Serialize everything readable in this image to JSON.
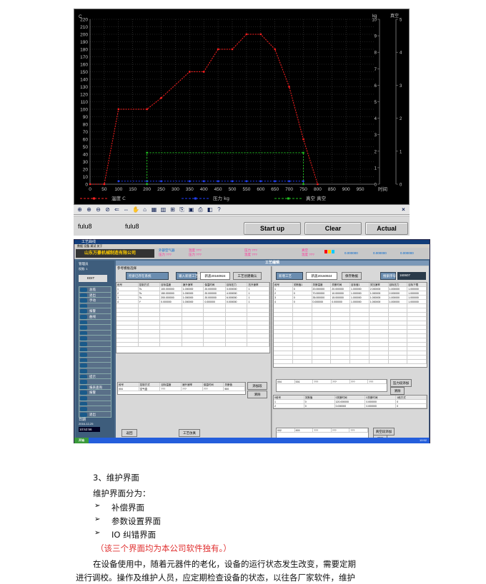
{
  "chart_data": {
    "type": "line",
    "x_ticks": [
      "0",
      "50",
      "100",
      "150",
      "200",
      "250",
      "300",
      "350",
      "400",
      "450",
      "500",
      "550",
      "600",
      "650",
      "700",
      "750",
      "800",
      "850",
      "900",
      "950"
    ],
    "x_unit_label": "时间",
    "y_left_ticks": [
      "0",
      "10",
      "20",
      "30",
      "40",
      "50",
      "60",
      "70",
      "80",
      "90",
      "100",
      "110",
      "120",
      "130",
      "140",
      "150",
      "160",
      "170",
      "180",
      "190",
      "200",
      "210",
      "220"
    ],
    "y_left_unit": "C",
    "y_mid_ticks": [
      "0",
      "1",
      "2",
      "3",
      "4",
      "5",
      "6",
      "7",
      "8",
      "9",
      "10"
    ],
    "y_mid_unit": "kg",
    "y_right_ticks": [
      "0",
      "1",
      "2",
      "3",
      "4",
      "5"
    ],
    "y_right_unit": "真空",
    "xlim": [
      0,
      1000
    ],
    "ylim": [
      0,
      220
    ],
    "series": [
      {
        "name": "温度 C",
        "color": "#ff2020",
        "x": [
          0,
          50,
          100,
          200,
          250,
          350,
          400,
          450,
          500,
          550,
          600,
          650,
          700,
          750,
          800
        ],
        "y": [
          0,
          0,
          100,
          100,
          115,
          150,
          150,
          180,
          180,
          200,
          200,
          180,
          130,
          60,
          0
        ]
      },
      {
        "name": "压力 kg",
        "color": "#2040ff",
        "x": [
          100,
          200,
          250,
          350,
          400,
          450,
          500,
          550,
          600,
          650,
          700,
          750
        ],
        "y": [
          4,
          4,
          4,
          4,
          4,
          4,
          4,
          4,
          4,
          4,
          4,
          4
        ]
      },
      {
        "name": "真空 真空",
        "color": "#20c020",
        "x": [
          200,
          200,
          750,
          750
        ],
        "y": [
          0,
          42,
          42,
          0
        ]
      }
    ]
  },
  "toolbar": {
    "icons": [
      "zoom-icon",
      "zoom-in-icon",
      "zoom-out-icon",
      "magnify-icon",
      "pan-icon",
      "move-icon",
      "hand-icon",
      "select-icon",
      "grid-icon",
      "chart-icon",
      "data-icon",
      "copy-icon",
      "save-icon",
      "print-icon",
      "preview-icon",
      "help-icon"
    ],
    "close_label": "×"
  },
  "bottom_bar": {
    "file_left": "fulu8",
    "file_right": "fulu8",
    "start_label": "Start up",
    "clear_label": "Clear",
    "actual_label": "Actual"
  },
  "process_window": {
    "title": "工艺曲线",
    "menu": "数据  设备  调试  关于",
    "company": "山东万豪机械制造有限公司",
    "header_labels": [
      "外部空气器",
      "压力 ???",
      "温度 ???",
      "压力 ???",
      "压力 ???",
      "温度 ???",
      "真空",
      "温度 ???"
    ],
    "header_values": [
      "0.000000",
      "0.000000",
      "0.000000"
    ],
    "section_title": "工艺编辑",
    "sidebar": {
      "user": "管理员",
      "user_sub": "权限: 1",
      "edit": "EDIT",
      "items": [
        "总揽",
        "退出",
        "手动",
        "",
        "报警",
        "曲线",
        "",
        "",
        "",
        "",
        "",
        "",
        "",
        "",
        "",
        "",
        "提示",
        "",
        "报表查询",
        "报警",
        "",
        "",
        "",
        "退出"
      ],
      "date_label": "日期",
      "date": "2016-12-25",
      "time": "10:52:56"
    },
    "left_panel": {
      "tab": "参考模板选择",
      "load_btn": "检索已存在系统",
      "import_btn": "输入新建工艺名",
      "name_value": "新盖20160924",
      "confirm_btn": "工艺创建确认",
      "columns": [
        "段号",
        "控制方式",
        "目标温度",
        "速升速率",
        "保温时间",
        "目标压力",
        "压升速率"
      ],
      "rows": [
        [
          "1",
          "Ts",
          "100.000000",
          "1.000000",
          "20.000000",
          "3.000000",
          "1"
        ],
        [
          "2",
          "Ts",
          "150.000000",
          "1.000000",
          "20.000000",
          "4.000000",
          "1"
        ],
        [
          "3",
          "Ts",
          "200.000000",
          "1.000000",
          "20.000000",
          "6.000000",
          "1"
        ],
        [
          "4",
          "Y",
          "0.000000",
          "1.000000",
          "0.000000",
          "0.000000",
          "1"
        ]
      ],
      "form_cols": [
        "段号",
        "控制方式",
        "目标温度",
        "速升速率",
        "保温时间",
        "关断值"
      ],
      "form_vals": [
        "004",
        "空气盒",
        "???",
        "???",
        "???",
        "500"
      ],
      "add_btn": "添加段",
      "clear_btn": "清除",
      "back_btn": "返回",
      "sim_btn": "工艺仿真"
    },
    "right_panel": {
      "new_btn": "新增工艺",
      "name_value": "新盖20160924",
      "save_btn": "保存数据",
      "search_label": "搜索序号",
      "search_value": "160607",
      "columns": [
        "段号",
        "关断值1",
        "关断温度",
        "关断时间",
        "目标值1",
        "关压速率",
        "目标压力",
        "目标下限"
      ],
      "rows": [
        [
          "1",
          "0",
          "20.000000",
          "20.000000",
          "1.000000",
          "2.000000",
          "1.000000",
          "1.000000"
        ],
        [
          "2",
          "0",
          "70.000000",
          "10.000000",
          "1.000000",
          "1.000000",
          "2.000000",
          "1.000000"
        ],
        [
          "3",
          "0",
          "35.000000",
          "15.000000",
          "1.000000",
          "1.000000",
          "1.000000",
          "1.000000"
        ],
        [
          "4",
          "0",
          "0.000000",
          "0.000000",
          "1.000000",
          "1.000000",
          "1.000000",
          "1.000000"
        ]
      ],
      "form_vals": [
        "004",
        "001",
        "???",
        "???",
        "???",
        "???"
      ],
      "add_btn": "压力段添加",
      "clear_btn": "清除",
      "sub_cols": [
        "0段号",
        "关断值",
        "0关断时间",
        "0关断时间",
        "1段方式"
      ],
      "sub_rows": [
        [
          "1",
          "0",
          "120.000000",
          "0.000000",
          "0"
        ],
        [
          "2",
          "0",
          "0.000000",
          "0.000000",
          "0"
        ]
      ],
      "bottom_vals": [
        "002",
        "003",
        "???",
        "???",
        "???"
      ],
      "bottom_add": "真空段添加",
      "bottom_clear": "清除"
    },
    "taskbar": {
      "start": "开始",
      "time": "10:52"
    }
  },
  "text": {
    "heading": "3、维护界面",
    "intro": "维护界面分为：",
    "items": [
      "补偿界面",
      "参数设置界面",
      "IO 纠错界面"
    ],
    "note": "（该三个界面均为本公司软件独有。）",
    "para1": "在设备使用中，随着元器件的老化，设备的运行状态发生改变，需要定期",
    "para2": "进行调校。操作及维护人员，应定期检查设备的状态，以往各厂家软件，维护"
  }
}
